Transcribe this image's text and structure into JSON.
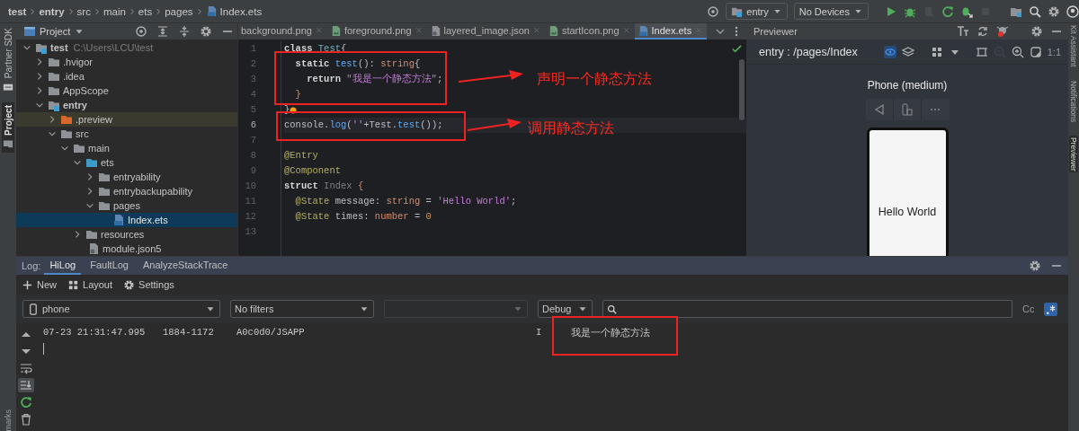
{
  "breadcrumb": [
    {
      "label": "test",
      "kind": "module"
    },
    {
      "label": "entry",
      "kind": "module"
    },
    {
      "label": "src",
      "kind": "folder"
    },
    {
      "label": "main",
      "kind": "folder"
    },
    {
      "label": "ets",
      "kind": "folder"
    },
    {
      "label": "pages",
      "kind": "folder"
    },
    {
      "label": "Index.ets",
      "kind": "file"
    }
  ],
  "run_toolbar": {
    "module": "entry",
    "device": "No Devices",
    "actions": [
      {
        "kind": "run",
        "disabled": false
      },
      {
        "kind": "debug",
        "disabled": false
      },
      {
        "kind": "attach",
        "disabled": true
      },
      {
        "kind": "rerun",
        "disabled": false
      },
      {
        "kind": "apply",
        "disabled": false
      },
      {
        "kind": "stop",
        "disabled": true
      }
    ]
  },
  "left_strip": [
    {
      "label": "Partner SDK",
      "selected": false
    },
    {
      "label": "Project",
      "selected": true
    }
  ],
  "left_strip_bottom": "marks",
  "right_strip": [
    {
      "label": "Kit Assistant",
      "selected": false
    },
    {
      "label": "Notifications",
      "selected": false
    },
    {
      "label": "Previewer",
      "selected": true
    }
  ],
  "project": {
    "title": "Project",
    "tree": [
      {
        "name": "test",
        "kind": "module",
        "note": "C:\\Users\\LCU\\test",
        "expanded": true,
        "selected": false,
        "children": [
          {
            "name": ".hvigor",
            "kind": "folder",
            "expanded": false,
            "selected": false
          },
          {
            "name": ".idea",
            "kind": "folder",
            "expanded": false,
            "selected": false
          },
          {
            "name": "AppScope",
            "kind": "folder",
            "expanded": false,
            "selected": false
          },
          {
            "name": "entry",
            "kind": "module",
            "expanded": true,
            "selected": false,
            "children": [
              {
                "name": ".preview",
                "kind": "excluded-folder",
                "expanded": false,
                "selected": false
              },
              {
                "name": "src",
                "kind": "folder",
                "expanded": true,
                "selected": false,
                "children": [
                  {
                    "name": "main",
                    "kind": "folder",
                    "expanded": true,
                    "selected": false,
                    "children": [
                      {
                        "name": "ets",
                        "kind": "source-folder",
                        "expanded": true,
                        "selected": false,
                        "children": [
                          {
                            "name": "entryability",
                            "kind": "folder",
                            "expanded": false,
                            "selected": false
                          },
                          {
                            "name": "entrybackupability",
                            "kind": "folder",
                            "expanded": false,
                            "selected": false
                          },
                          {
                            "name": "pages",
                            "kind": "folder",
                            "expanded": true,
                            "selected": false,
                            "children": [
                              {
                                "name": "Index.ets",
                                "kind": "ets-file",
                                "selected": true
                              }
                            ]
                          }
                        ]
                      },
                      {
                        "name": "resources",
                        "kind": "folder",
                        "expanded": false,
                        "selected": false
                      },
                      {
                        "name": "module.json5",
                        "kind": "json-file",
                        "selected": false
                      }
                    ]
                  }
                ]
              }
            ]
          }
        ]
      }
    ]
  },
  "editor": {
    "tabs": [
      {
        "label": "background.png",
        "kind": "scrolled",
        "selected": false
      },
      {
        "label": "foreground.png",
        "kind": "image",
        "selected": false
      },
      {
        "label": "layered_image.json",
        "kind": "json",
        "selected": false
      },
      {
        "label": "startIcon.png",
        "kind": "image",
        "selected": false
      },
      {
        "label": "Index.ets",
        "kind": "ets",
        "selected": true
      }
    ],
    "lines": [
      {
        "n": "1",
        "current": false,
        "bulb": false,
        "tokens": [
          {
            "kind": "kw",
            "t": "class "
          },
          {
            "kind": "cls",
            "t": "Test"
          },
          {
            "kind": "p",
            "t": "{"
          }
        ]
      },
      {
        "n": "2",
        "current": false,
        "bulb": false,
        "tokens": [
          {
            "kind": "kw",
            "t": "  static "
          },
          {
            "kind": "fn",
            "t": "test"
          },
          {
            "kind": "p",
            "t": "(): "
          },
          {
            "kind": "type",
            "t": "string"
          },
          {
            "kind": "p",
            "t": "{"
          }
        ]
      },
      {
        "n": "3",
        "current": false,
        "bulb": false,
        "tokens": [
          {
            "kind": "kw",
            "t": "    return "
          },
          {
            "kind": "str",
            "t": "\"我是一个静态方法\""
          },
          {
            "kind": "p",
            "t": ";"
          }
        ]
      },
      {
        "n": "4",
        "current": false,
        "bulb": false,
        "tokens": [
          {
            "kind": "type",
            "t": "  }"
          }
        ]
      },
      {
        "n": "5",
        "current": false,
        "bulb": true,
        "tokens": [
          {
            "kind": "p",
            "t": "}"
          }
        ]
      },
      {
        "n": "6",
        "current": true,
        "bulb": false,
        "tokens": [
          {
            "kind": "p",
            "t": "console."
          },
          {
            "kind": "fn",
            "t": "log"
          },
          {
            "kind": "p",
            "t": "("
          },
          {
            "kind": "str",
            "t": "''"
          },
          {
            "kind": "p",
            "t": "+Test."
          },
          {
            "kind": "fn",
            "t": "test"
          },
          {
            "kind": "p",
            "t": "());"
          }
        ]
      },
      {
        "n": "7",
        "current": false
      },
      {
        "n": "8",
        "current": false,
        "bulb": false,
        "tokens": [
          {
            "kind": "dec",
            "t": "@Entry"
          }
        ]
      },
      {
        "n": "9",
        "current": false,
        "bulb": false,
        "tokens": [
          {
            "kind": "dec",
            "t": "@Component"
          }
        ]
      },
      {
        "n": "10",
        "current": false,
        "bulb": false,
        "tokens": [
          {
            "kind": "kw",
            "t": "struct "
          },
          {
            "kind": "dim",
            "t": "Index"
          },
          {
            "kind": "type",
            "t": " {"
          }
        ]
      },
      {
        "n": "11",
        "current": false,
        "bulb": false,
        "tokens": [
          {
            "kind": "dec",
            "t": "  @State"
          },
          {
            "kind": "p",
            "t": " message: "
          },
          {
            "kind": "type",
            "t": "string"
          },
          {
            "kind": "p",
            "t": " = "
          },
          {
            "kind": "str",
            "t": "'Hello World'"
          },
          {
            "kind": "p",
            "t": ";"
          }
        ]
      },
      {
        "n": "12",
        "current": false,
        "bulb": false,
        "tokens": [
          {
            "kind": "dec",
            "t": "  @State"
          },
          {
            "kind": "p",
            "t": " times: "
          },
          {
            "kind": "type",
            "t": "number"
          },
          {
            "kind": "p",
            "t": " = "
          },
          {
            "kind": "num",
            "t": "0"
          }
        ]
      },
      {
        "n": "13",
        "current": false
      }
    ],
    "annotations": [
      {
        "label": "声明一个静态方法"
      },
      {
        "label": "调用静态方法"
      }
    ]
  },
  "previewer": {
    "title": "Previewer",
    "target": "entry : /pages/Index",
    "zoom_label": "1:1",
    "device": "Phone (medium)",
    "screen_text": "Hello World"
  },
  "log": {
    "label": "Log:",
    "tabs": [
      {
        "label": "HiLog",
        "selected": true
      },
      {
        "label": "FaultLog",
        "selected": false
      },
      {
        "label": "AnalyzeStackTrace",
        "selected": false
      }
    ],
    "toolbar": [
      {
        "kind": "new",
        "label": "New"
      },
      {
        "kind": "layout",
        "label": "Layout"
      },
      {
        "kind": "settings",
        "label": "Settings"
      }
    ],
    "filters": [
      {
        "kind": "device",
        "value": "phone",
        "disabled": false
      },
      {
        "kind": "plain",
        "value": "No filters",
        "disabled": false
      },
      {
        "kind": "plain",
        "disabled": true
      },
      {
        "kind": "plain",
        "value": "Debug",
        "disabled": false
      }
    ],
    "match_case": "Cc",
    "regex_on": true,
    "side_actions": [
      {
        "kind": "up",
        "selected": false
      },
      {
        "kind": "down",
        "selected": false
      },
      {
        "kind": "wrap",
        "selected": false
      },
      {
        "kind": "scroll-end",
        "selected": true
      },
      {
        "kind": "restart",
        "selected": false
      },
      {
        "kind": "delete",
        "selected": false
      }
    ],
    "entries": [
      {
        "time": "07-23 21:31:47.995",
        "pid": "1884-1172",
        "tag": "A0c0d0/JSAPP",
        "level": "I",
        "message": "我是一个静态方法",
        "highlighted": true
      }
    ]
  }
}
